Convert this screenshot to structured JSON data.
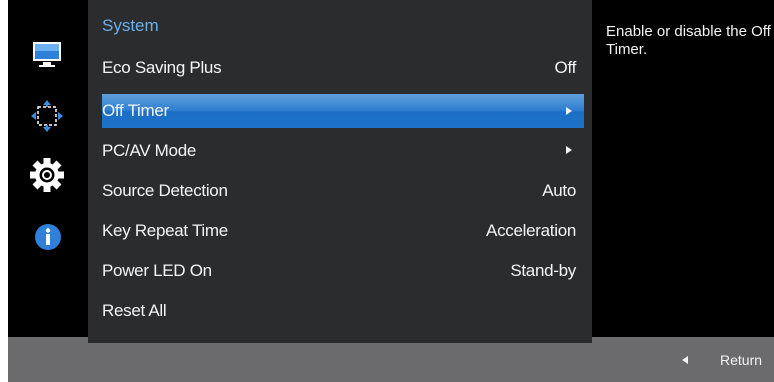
{
  "menu": {
    "title": "System",
    "items": [
      {
        "label": "Eco Saving Plus",
        "value": "Off",
        "arrow": false,
        "selected": false
      },
      {
        "label": "Off Timer",
        "value": "",
        "arrow": true,
        "selected": true
      },
      {
        "label": "PC/AV Mode",
        "value": "",
        "arrow": true,
        "selected": false
      },
      {
        "label": "Source Detection",
        "value": "Auto",
        "arrow": false,
        "selected": false
      },
      {
        "label": "Key Repeat Time",
        "value": "Acceleration",
        "arrow": false,
        "selected": false
      },
      {
        "label": "Power LED On",
        "value": "Stand-by",
        "arrow": false,
        "selected": false
      },
      {
        "label": "Reset All",
        "value": "",
        "arrow": false,
        "selected": false
      }
    ]
  },
  "help": {
    "text": "Enable or disable the Off Timer."
  },
  "footer": {
    "return_label": "Return"
  },
  "sidebar": {
    "icons": [
      "monitor-icon",
      "screen-adjust-icon",
      "gear-icon",
      "info-icon"
    ],
    "active": "gear-icon"
  },
  "colors": {
    "menu_title": "#6ab0ec",
    "selection": "#1c6fc4",
    "panel": "#2b2c2e",
    "bottom_bar": "#6b6b6d",
    "info_blue": "#2f80d8"
  }
}
